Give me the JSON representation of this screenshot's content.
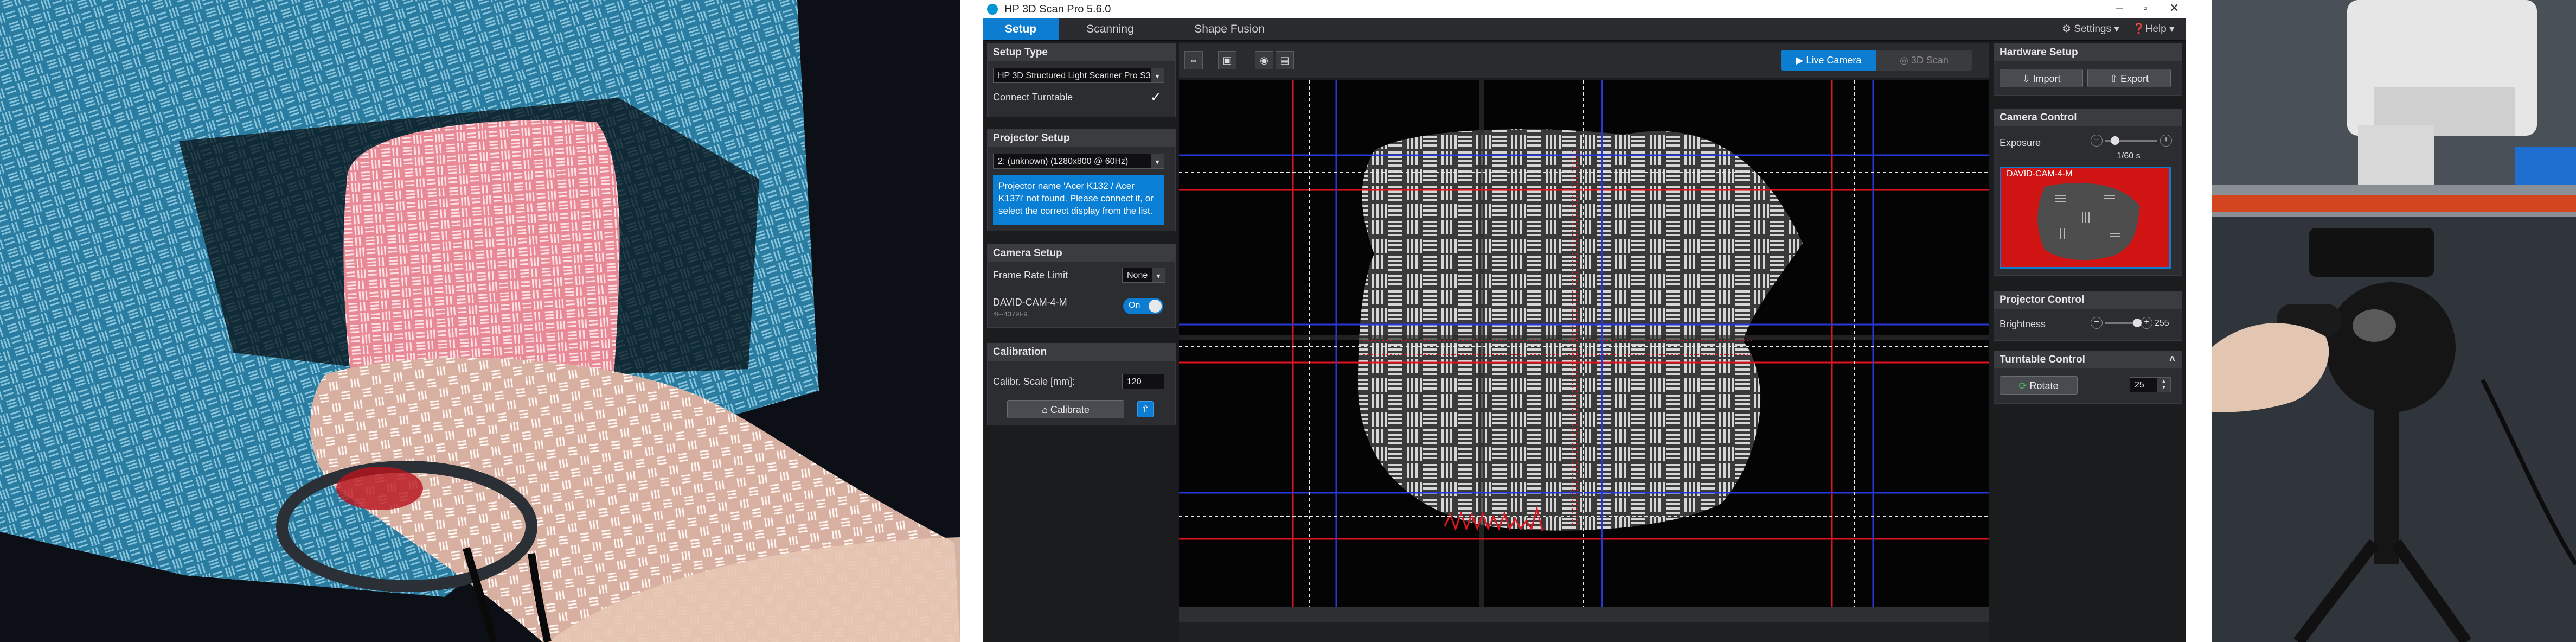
{
  "app": {
    "title": "HP 3D Scan Pro 5.6.0",
    "tabs": [
      "Setup",
      "Scanning",
      "Shape Fusion"
    ],
    "settings_label": "Settings ▾",
    "help_label": "Help ▾"
  },
  "setup_type": {
    "header": "Setup Type",
    "scanner_value": "HP 3D Structured Light Scanner Pro S3",
    "connect_turntable_label": "Connect Turntable",
    "connect_turntable_checked": true
  },
  "projector_setup": {
    "header": "Projector Setup",
    "display_value": "2: (unknown) (1280x800 @ 60Hz)",
    "notice": "Projector name 'Acer K132 / Acer K137i' not found. Please connect it, or select the correct display from the list."
  },
  "camera_setup": {
    "header": "Camera Setup",
    "frame_rate_label": "Frame Rate Limit",
    "frame_rate_value": "None",
    "camera_name": "DAVID-CAM-4-M",
    "camera_serial": "4F-4379F9",
    "camera_toggle": "On"
  },
  "calibration": {
    "header": "Calibration",
    "scale_label": "Calibr. Scale [mm]:",
    "scale_value": "120",
    "calibrate_label": "Calibrate"
  },
  "toolbar": {
    "live_camera_label": "Live Camera",
    "scan_3d_label": "3D Scan"
  },
  "hardware_setup": {
    "header": "Hardware Setup",
    "import_label": "Import",
    "export_label": "Export"
  },
  "camera_control": {
    "header": "Camera Control",
    "exposure_label": "Exposure",
    "exposure_value": "1/60 s",
    "exposure_level": 0.2,
    "preview_label": "DAVID-CAM-4-M"
  },
  "projector_control": {
    "header": "Projector Control",
    "brightness_label": "Brightness",
    "brightness_value": "255",
    "brightness_level": 1.0
  },
  "turntable_control": {
    "header": "Turntable Control",
    "rotate_label": "Rotate",
    "rotate_value": "25"
  },
  "colors": {
    "accent": "#0c7dd1",
    "overlay_red": "#e0141e",
    "overlay_blue": "#2a37d8",
    "preview_bg": "#d01414"
  }
}
